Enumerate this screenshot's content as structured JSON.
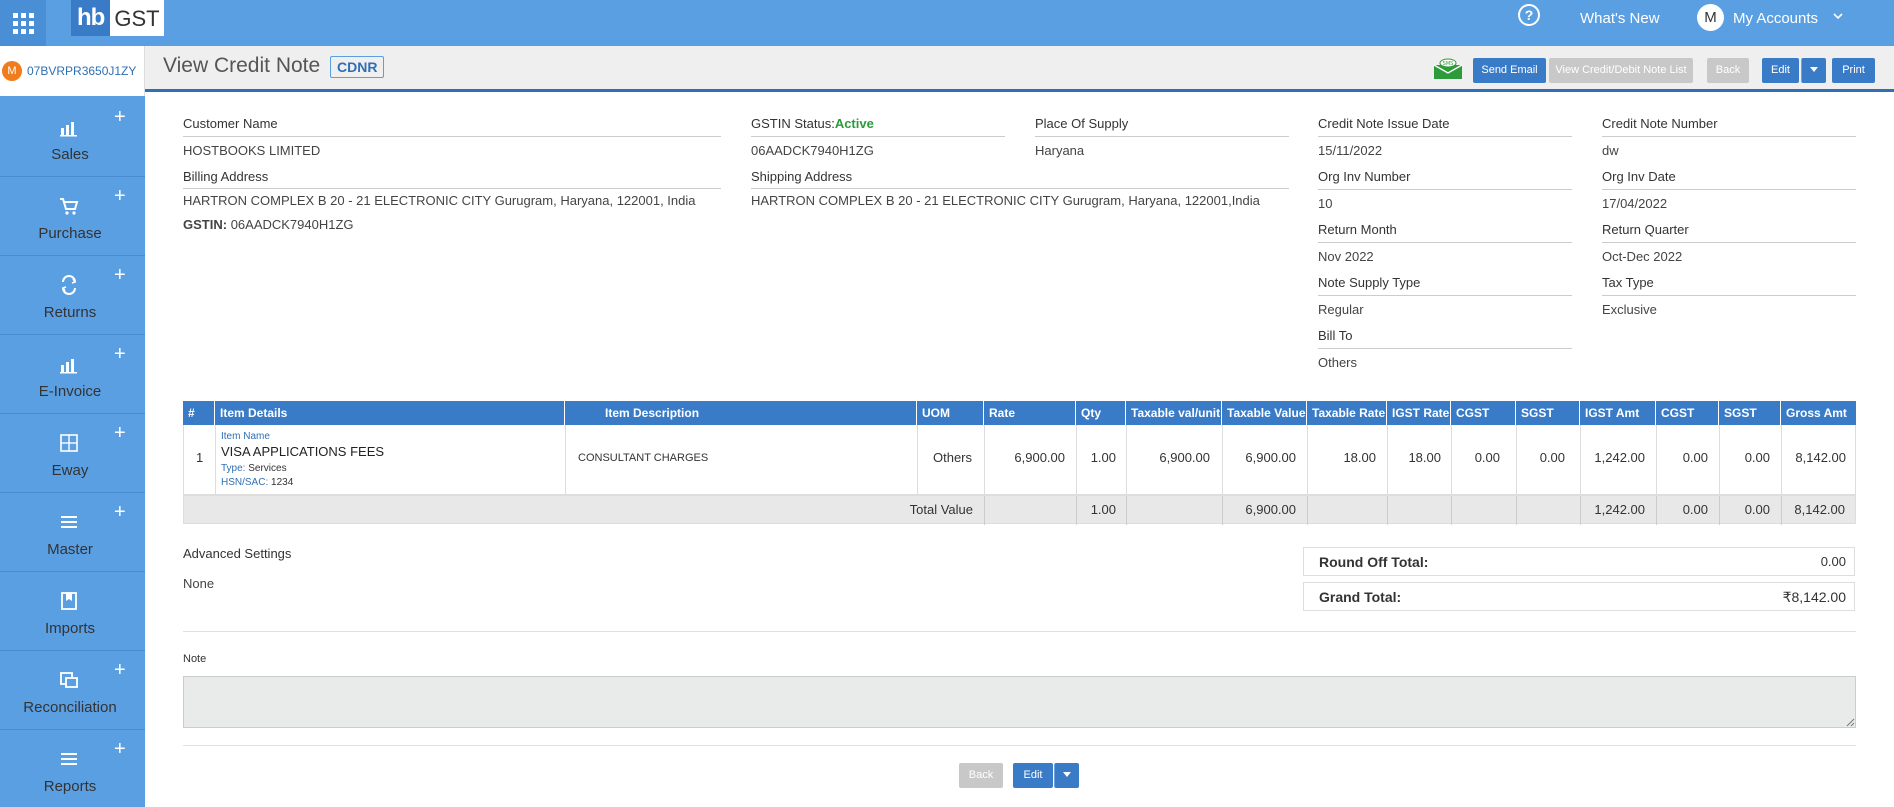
{
  "topbar": {
    "logo_hb": "hb",
    "logo_gst": "GST",
    "help_label": "?",
    "whats_new": "What's New",
    "account_initial": "M",
    "my_accounts": "My Accounts"
  },
  "sidebar": {
    "org_initial": "M",
    "org_gstin": "07BVRPR3650J1ZY",
    "items": [
      {
        "label": "Sales",
        "icon": "bar-chart-icon",
        "plus": true
      },
      {
        "label": "Purchase",
        "icon": "cart-icon",
        "plus": true
      },
      {
        "label": "Returns",
        "icon": "returns-icon",
        "plus": true
      },
      {
        "label": "E-Invoice",
        "icon": "bar-chart-icon",
        "plus": true
      },
      {
        "label": "Eway",
        "icon": "grid-box-icon",
        "plus": true
      },
      {
        "label": "Master",
        "icon": "menu-icon",
        "plus": true
      },
      {
        "label": "Imports",
        "icon": "bookmark-icon",
        "plus": false
      },
      {
        "label": "Reconciliation",
        "icon": "copy-icon",
        "plus": true
      },
      {
        "label": "Reports",
        "icon": "menu-icon",
        "plus": true
      }
    ]
  },
  "header": {
    "title": "View Credit Note",
    "badge": "CDNR",
    "sms_label": "SMS",
    "buttons": {
      "send_email": "Send Email",
      "view_list": "View Credit/Debit Note List",
      "back": "Back",
      "edit": "Edit",
      "print": "Print"
    }
  },
  "details": {
    "customer_name_label": "Customer Name",
    "customer_name": "HOSTBOOKS LIMITED",
    "billing_address_label": "Billing Address",
    "billing_address": "HARTRON COMPLEX B 20 - 21 ELECTRONIC CITY Gurugram, Haryana, 122001, India",
    "gstin_label": "GSTIN:",
    "gstin": "06AADCK7940H1ZG",
    "gstin_status_label": "GSTIN Status:",
    "gstin_status": "Active",
    "gstin_status_value": "06AADCK7940H1ZG",
    "place_of_supply_label": "Place Of Supply",
    "place_of_supply": "Haryana",
    "shipping_address_label": "Shipping Address",
    "shipping_address": "HARTRON COMPLEX B 20 - 21 ELECTRONIC CITY Gurugram, Haryana, 122001,India",
    "issue_date_label": "Credit Note Issue Date",
    "issue_date": "15/11/2022",
    "note_number_label": "Credit Note Number",
    "note_number": "dw",
    "org_inv_number_label": "Org Inv Number",
    "org_inv_number": "10",
    "org_inv_date_label": "Org Inv Date",
    "org_inv_date": "17/04/2022",
    "return_month_label": "Return Month",
    "return_month": "Nov 2022",
    "return_quarter_label": "Return Quarter",
    "return_quarter": "Oct-Dec 2022",
    "note_supply_type_label": "Note Supply Type",
    "note_supply_type": "Regular",
    "tax_type_label": "Tax Type",
    "tax_type": "Exclusive",
    "bill_to_label": "Bill To",
    "bill_to": "Others"
  },
  "table": {
    "headers": [
      "#",
      "Item Details",
      "Item Description",
      "UOM",
      "Rate",
      "Qty",
      "Taxable val/unit",
      "Taxable Value",
      "Taxable Rate",
      "IGST Rate",
      "CGST Rate",
      "SGST Rate",
      "IGST Amt",
      "CGST Amt",
      "SGST Amt",
      "Gross Amt"
    ],
    "rows": [
      {
        "num": "1",
        "item_name_label": "Item Name",
        "item_name": "VISA APPLICATIONS FEES",
        "type_label": "Type:",
        "type": "Services",
        "hsn_label": "HSN/SAC:",
        "hsn": "1234",
        "description": "CONSULTANT CHARGES",
        "uom": "Others",
        "rate": "6,900.00",
        "qty": "1.00",
        "taxable_val_unit": "6,900.00",
        "taxable_value": "6,900.00",
        "taxable_rate": "18.00",
        "igst_rate": "18.00",
        "cgst_rate": "0.00",
        "sgst_rate": "0.00",
        "igst_amt": "1,242.00",
        "cgst_amt": "0.00",
        "sgst_amt": "0.00",
        "gross_amt": "8,142.00"
      }
    ],
    "total": {
      "label": "Total Value",
      "qty": "1.00",
      "taxable_value": "6,900.00",
      "igst_amt": "1,242.00",
      "cgst_amt": "0.00",
      "sgst_amt": "0.00",
      "gross_amt": "8,142.00"
    }
  },
  "advanced": {
    "label": "Advanced Settings",
    "value": "None"
  },
  "summary": {
    "round_off_label": "Round Off Total:",
    "round_off": "0.00",
    "grand_total_label": "Grand Total:",
    "grand_total": "₹8,142.00"
  },
  "note": {
    "label": "Note",
    "value": ""
  },
  "footer": {
    "back": "Back",
    "edit": "Edit"
  },
  "colors": {
    "primary": "#5b9fe3",
    "button": "#3a7bc8",
    "active": "#2e9b3a",
    "org_avatar": "#f07c1c"
  }
}
